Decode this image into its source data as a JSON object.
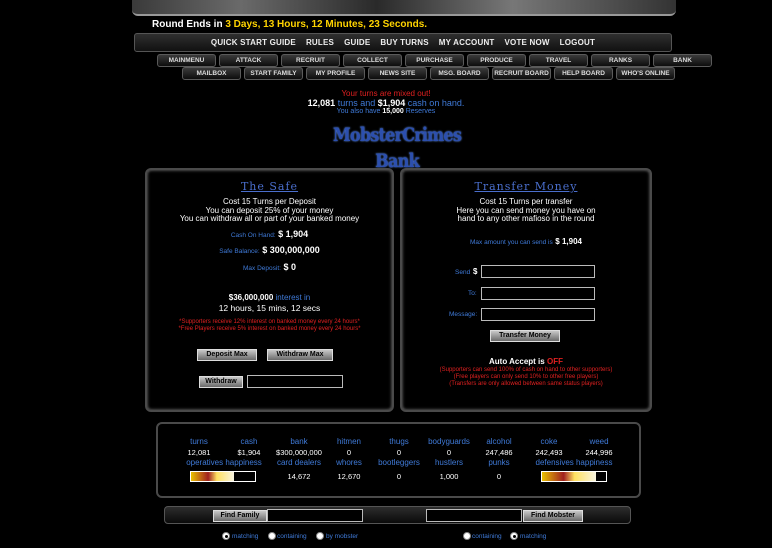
{
  "round": {
    "prefix": "Round Ends in",
    "time": "3 Days, 13 Hours, 12 Minutes, 23 Seconds."
  },
  "top_nav": [
    "QUICK START GUIDE",
    "RULES",
    "GUIDE",
    "BUY TURNS",
    "MY ACCOUNT",
    "VOTE NOW",
    "LOGOUT"
  ],
  "tabs_row1": [
    "MAINMENU",
    "ATTACK",
    "RECRUIT",
    "COLLECT",
    "PURCHASE",
    "PRODUCE",
    "TRAVEL",
    "RANKS",
    "BANK"
  ],
  "tabs_row2": [
    "MAILBOX",
    "START FAMILY",
    "MY PROFILE",
    "NEWS SITE",
    "MSG. BOARD",
    "RECRUIT BOARD",
    "HELP BOARD",
    "WHO'S ONLINE"
  ],
  "status": {
    "turns_mixed": "Your turns are mixed out!",
    "turns": "12,081",
    "turns_and": "turns and",
    "cash": "$1,904",
    "cash_on_hand": "cash on hand.",
    "also_have": "You also have",
    "reserves": "15,000",
    "reserves_label": "Reserves"
  },
  "bank_title": "MobsterCrimes Bank",
  "safe": {
    "title": "The Safe",
    "cost": "Cost 15 Turns per Deposit",
    "deposit_info": "You can deposit 25% of your money",
    "withdraw_info": "You can withdraw all or part of your banked money",
    "cash_on_hand_label": "Cash On Hand:",
    "cash_on_hand": "$ 1,904",
    "safe_balance_label": "Safe Balance:",
    "safe_balance": "$ 300,000,000",
    "max_deposit_label": "Max Deposit:",
    "max_deposit": "$ 0",
    "interest_amount": "$36,000,000",
    "interest_in": "interest in",
    "interest_time": "12 hours, 15 mins, 12 secs",
    "supporters_note": "*Supporters receive 12% interest on banked money every 24 hours*",
    "free_note": "*Free Players receive 5% interest on banked money every 24 hours*",
    "deposit_max_btn": "Deposit Max",
    "withdraw_max_btn": "Withdraw Max",
    "withdraw_btn": "Withdraw"
  },
  "transfer": {
    "title": "Transfer Money",
    "cost": "Cost 15 Turns per transfer",
    "info1": "Here you can send money you have on",
    "info2": "hand to any other mafioso in the round",
    "max_label": "Max amount you can send is",
    "max_value": "$ 1,904",
    "send_label": "Send",
    "send_currency": "$",
    "to_label": "To:",
    "message_label": "Message:",
    "transfer_btn": "Transfer Money",
    "auto_accept_label": "Auto Accept is",
    "auto_accept_value": "OFF",
    "note1": "(Supporters can send 100% of cash on hand to other supporters)",
    "note2": "(Free players can only send 10% to other free players)",
    "note3": "(Transfers are only allowed between same status players)"
  },
  "stats": {
    "headers1": [
      "turns",
      "cash",
      "bank",
      "hitmen",
      "thugs",
      "bodyguards",
      "alcohol",
      "coke",
      "weed"
    ],
    "values1": [
      "12,081",
      "$1,904",
      "$300,000,000",
      "0",
      "0",
      "0",
      "247,486",
      "242,493",
      "244,996"
    ],
    "headers2": [
      "operatives happiness",
      "",
      "card dealers",
      "whores",
      "bootleggers",
      "hustlers",
      "punks",
      "defensives happiness",
      ""
    ],
    "values2": [
      "",
      "",
      "14,672",
      "12,670",
      "0",
      "1,000",
      "0",
      "",
      ""
    ],
    "operatives_happiness": 0.67,
    "defensives_happiness": 0.85
  },
  "find": {
    "family_btn": "Find Family",
    "mobster_btn": "Find Mobster",
    "left_radios": [
      "matching",
      "containing",
      "by mobster"
    ],
    "right_radios": [
      "containing",
      "matching"
    ]
  }
}
